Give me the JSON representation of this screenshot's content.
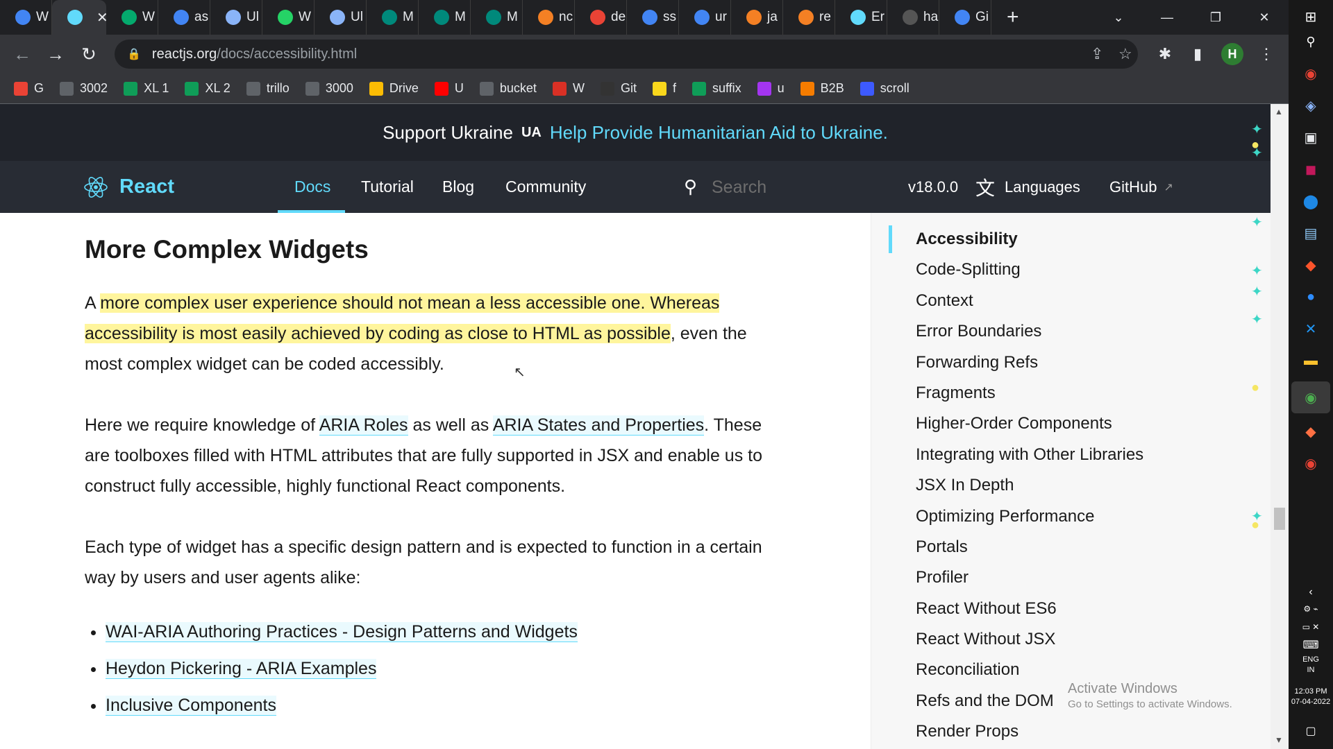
{
  "tabs": [
    {
      "label": "W",
      "icon": "google-icon",
      "color": "#4285f4"
    },
    {
      "label": "",
      "icon": "react-icon",
      "color": "#61dafb",
      "active": true
    },
    {
      "label": "W",
      "icon": "w3schools-icon",
      "color": "#04aa6d"
    },
    {
      "label": "as",
      "icon": "google-icon",
      "color": "#4285f4"
    },
    {
      "label": "Ul",
      "icon": "bookmark-icon",
      "color": "#8ab4f8"
    },
    {
      "label": "W",
      "icon": "whatsapp-icon",
      "color": "#25d366"
    },
    {
      "label": "Ul",
      "icon": "bookmark-icon",
      "color": "#8ab4f8"
    },
    {
      "label": "M",
      "icon": "meet-icon",
      "color": "#00897b"
    },
    {
      "label": "M",
      "icon": "meet-icon",
      "color": "#00897b"
    },
    {
      "label": "M",
      "icon": "meet-icon",
      "color": "#00897b"
    },
    {
      "label": "nc",
      "icon": "stackoverflow-icon",
      "color": "#f48024"
    },
    {
      "label": "de",
      "icon": "gmail-icon",
      "color": "#ea4335"
    },
    {
      "label": "ss",
      "icon": "google-icon",
      "color": "#4285f4"
    },
    {
      "label": "ur",
      "icon": "google-icon",
      "color": "#4285f4"
    },
    {
      "label": "ja",
      "icon": "stackoverflow-icon",
      "color": "#f48024"
    },
    {
      "label": "re",
      "icon": "stackoverflow-icon",
      "color": "#f48024"
    },
    {
      "label": "Er",
      "icon": "react-icon",
      "color": "#61dafb"
    },
    {
      "label": "ha",
      "icon": "github-icon",
      "color": "#555555"
    },
    {
      "label": "Gi",
      "icon": "google-icon",
      "color": "#4285f4"
    }
  ],
  "address": {
    "host": "reactjs.org",
    "path": "/docs/accessibility.html"
  },
  "profile_initial": "H",
  "bookmarks": [
    {
      "label": "G",
      "icon": "gmail-icon",
      "color": "#ea4335"
    },
    {
      "label": "3002",
      "icon": "bookmark-icon",
      "color": "#5f6368"
    },
    {
      "label": "XL 1",
      "icon": "sheets-icon",
      "color": "#0f9d58"
    },
    {
      "label": "XL 2",
      "icon": "sheets-icon",
      "color": "#0f9d58"
    },
    {
      "label": "trillo",
      "icon": "bookmark-icon",
      "color": "#5f6368"
    },
    {
      "label": "3000",
      "icon": "bookmark-icon",
      "color": "#5f6368"
    },
    {
      "label": "Drive",
      "icon": "drive-icon",
      "color": "#fbbc04"
    },
    {
      "label": "U",
      "icon": "youtube-icon",
      "color": "#ff0000"
    },
    {
      "label": "bucket",
      "icon": "globe-icon",
      "color": "#5f6368"
    },
    {
      "label": "W",
      "icon": "alert-icon",
      "color": "#d93025"
    },
    {
      "label": "Git",
      "icon": "github-icon",
      "color": "#333333"
    },
    {
      "label": "f",
      "icon": "flipkart-icon",
      "color": "#f9d71c"
    },
    {
      "label": "suffix",
      "icon": "sheets-icon",
      "color": "#0f9d58"
    },
    {
      "label": "u",
      "icon": "udemy-icon",
      "color": "#a435f0"
    },
    {
      "label": "B2B",
      "icon": "b2b-icon",
      "color": "#f57c00"
    },
    {
      "label": "scroll",
      "icon": "p-icon",
      "color": "#3d5afe"
    }
  ],
  "banner": {
    "text": "Support Ukraine",
    "ua": "UA",
    "link": "Help Provide Humanitarian Aid to Ukraine."
  },
  "header": {
    "logo": "React",
    "nav": [
      "Docs",
      "Tutorial",
      "Blog",
      "Community"
    ],
    "search_placeholder": "Search",
    "version": "v18.0.0",
    "languages": "Languages",
    "github": "GitHub"
  },
  "content": {
    "heading": "More Complex Widgets",
    "p1_pre": "A ",
    "p1_hl": "more complex user experience should not mean a less accessible one. Whereas accessibility is most easily achieved by coding as close to HTML as possible",
    "p1_post": ", even the most complex widget can be coded accessibly.",
    "p2_a": "Here we require knowledge of ",
    "p2_link1": "ARIA Roles",
    "p2_b": " as well as ",
    "p2_link2": "ARIA States and Properties",
    "p2_c": ". These are toolboxes filled with HTML attributes that are fully supported in JSX and enable us to construct fully accessible, highly functional React components.",
    "p3": "Each type of widget has a specific design pattern and is expected to function in a certain way by users and user agents alike:",
    "links": [
      "WAI-ARIA Authoring Practices - Design Patterns and Widgets",
      "Heydon Pickering - ARIA Examples",
      "Inclusive Components"
    ]
  },
  "sidebar": [
    "Accessibility",
    "Code-Splitting",
    "Context",
    "Error Boundaries",
    "Forwarding Refs",
    "Fragments",
    "Higher-Order Components",
    "Integrating with Other Libraries",
    "JSX In Depth",
    "Optimizing Performance",
    "Portals",
    "Profiler",
    "React Without ES6",
    "React Without JSX",
    "Reconciliation",
    "Refs and the DOM",
    "Render Props"
  ],
  "activate": {
    "title": "Activate Windows",
    "subtitle": "Go to Settings to activate Windows."
  },
  "taskbar": {
    "lang": "ENG",
    "region": "IN",
    "time": "12:03 PM",
    "date": "07-04-2022"
  }
}
